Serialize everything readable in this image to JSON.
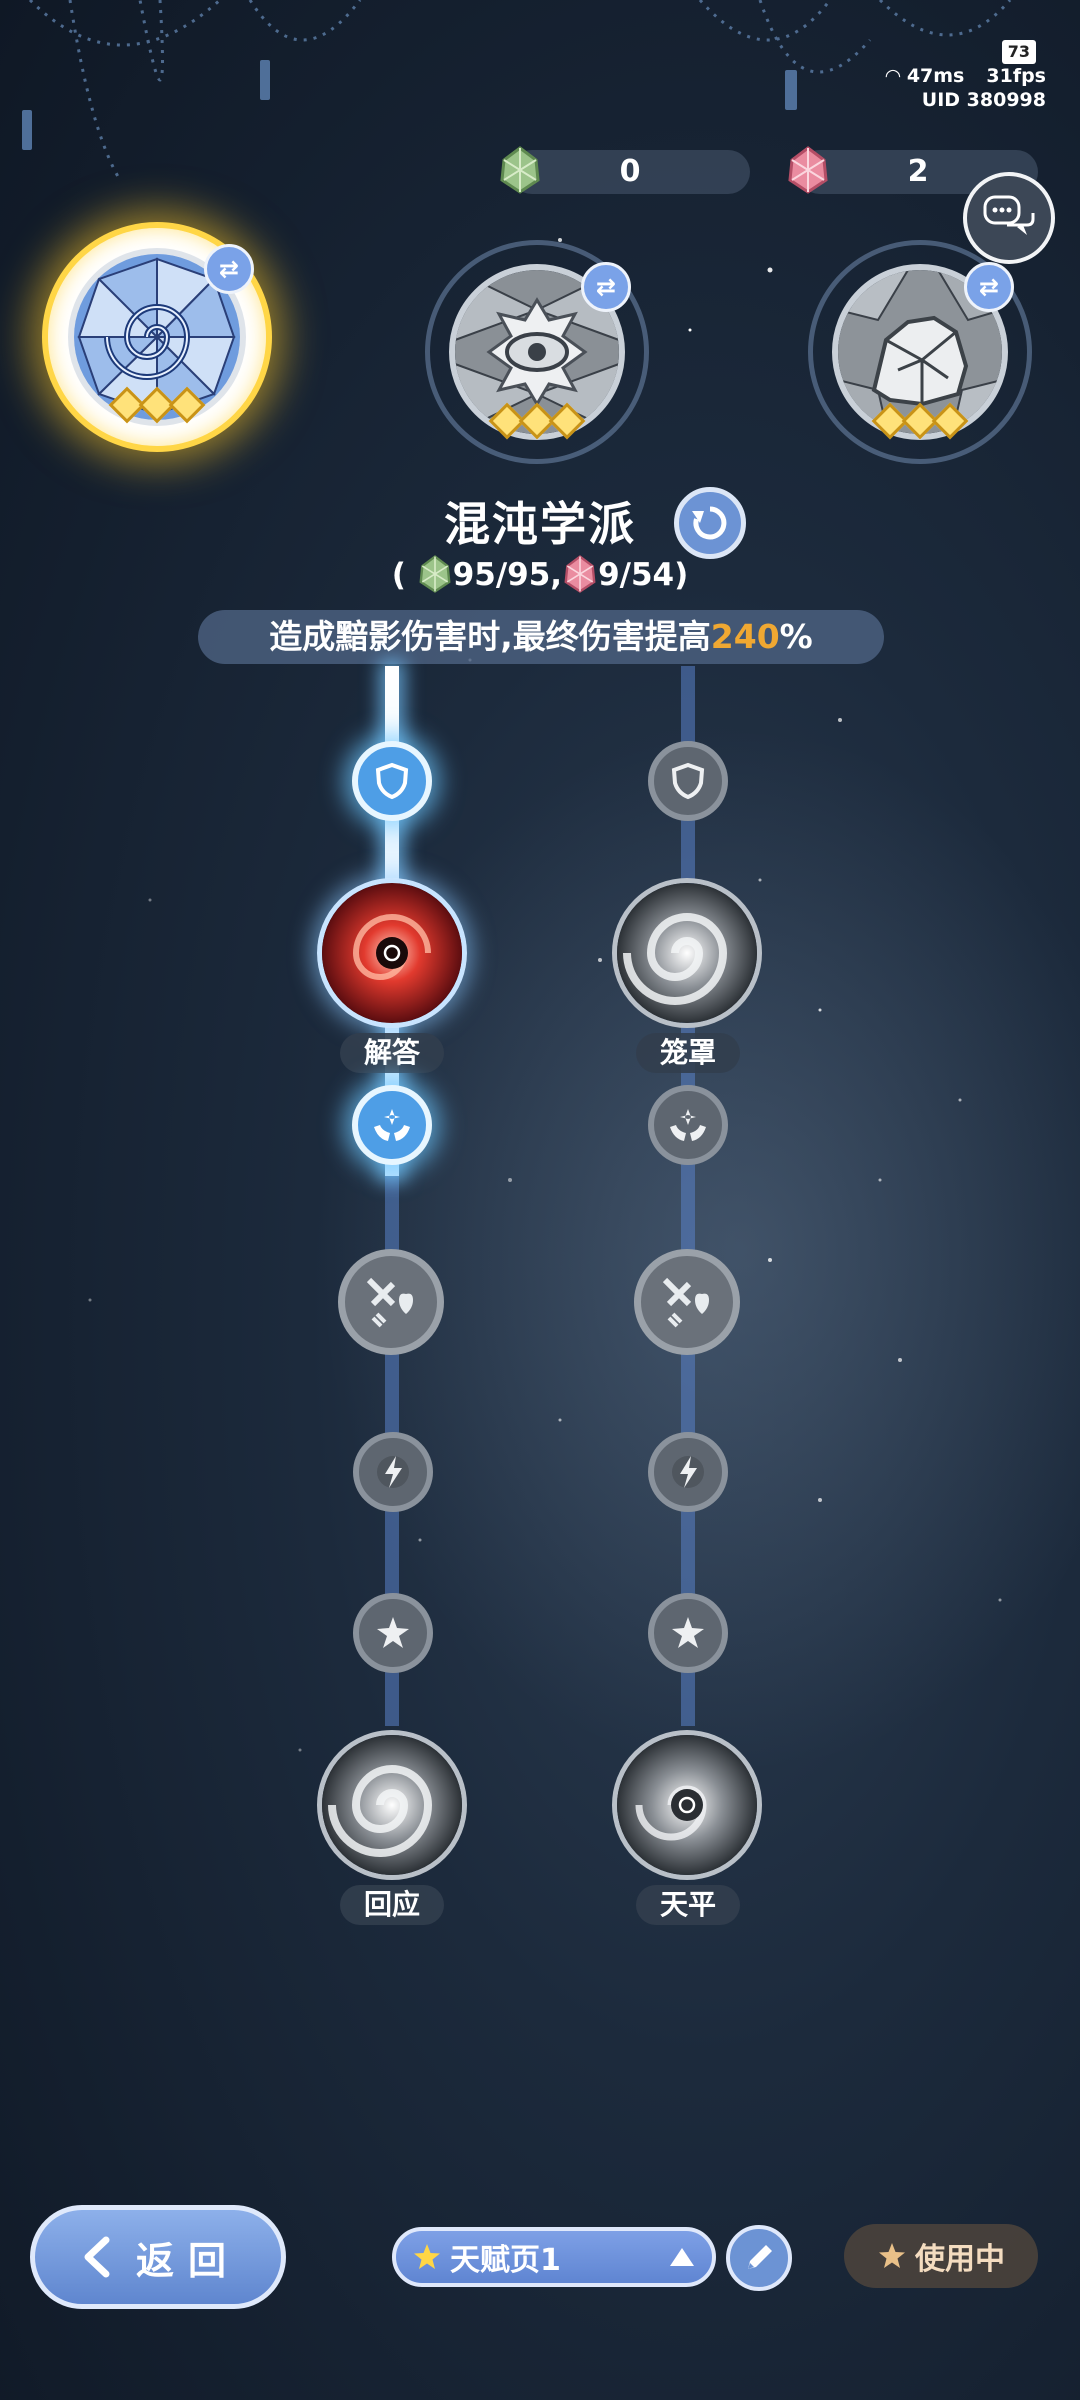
{
  "status": {
    "battery": "73",
    "ping": "47ms",
    "fps": "31fps",
    "uid": "UID 380998"
  },
  "currency": [
    {
      "icon": "green-crystal-icon",
      "value": "0"
    },
    {
      "icon": "pink-crystal-icon",
      "value": "2"
    }
  ],
  "schools": [
    {
      "icon": "vortex-emblem-icon",
      "stars": 3,
      "selected": true
    },
    {
      "icon": "eye-emblem-icon",
      "stars": 3,
      "selected": false
    },
    {
      "icon": "rock-emblem-icon",
      "stars": 3,
      "selected": false
    }
  ],
  "school": {
    "name": "混沌学派",
    "progress_open": "(",
    "green_progress": "95/95,",
    "pink_progress": "9/54)",
    "bonus_prefix": "造成黯影伤害时,最终伤害提高",
    "bonus_value": "240",
    "bonus_suffix": "%"
  },
  "skills": {
    "left_top": "解答",
    "right_top": "笼罩",
    "left_bottom": "回应",
    "right_bottom": "天平"
  },
  "bottom": {
    "back_label": "返回",
    "page_label": "天赋页1",
    "in_use_label": "使用中"
  },
  "colors": {
    "accent": "#6c93d4",
    "highlight": "#f0a832",
    "gold": "#ffd646"
  }
}
